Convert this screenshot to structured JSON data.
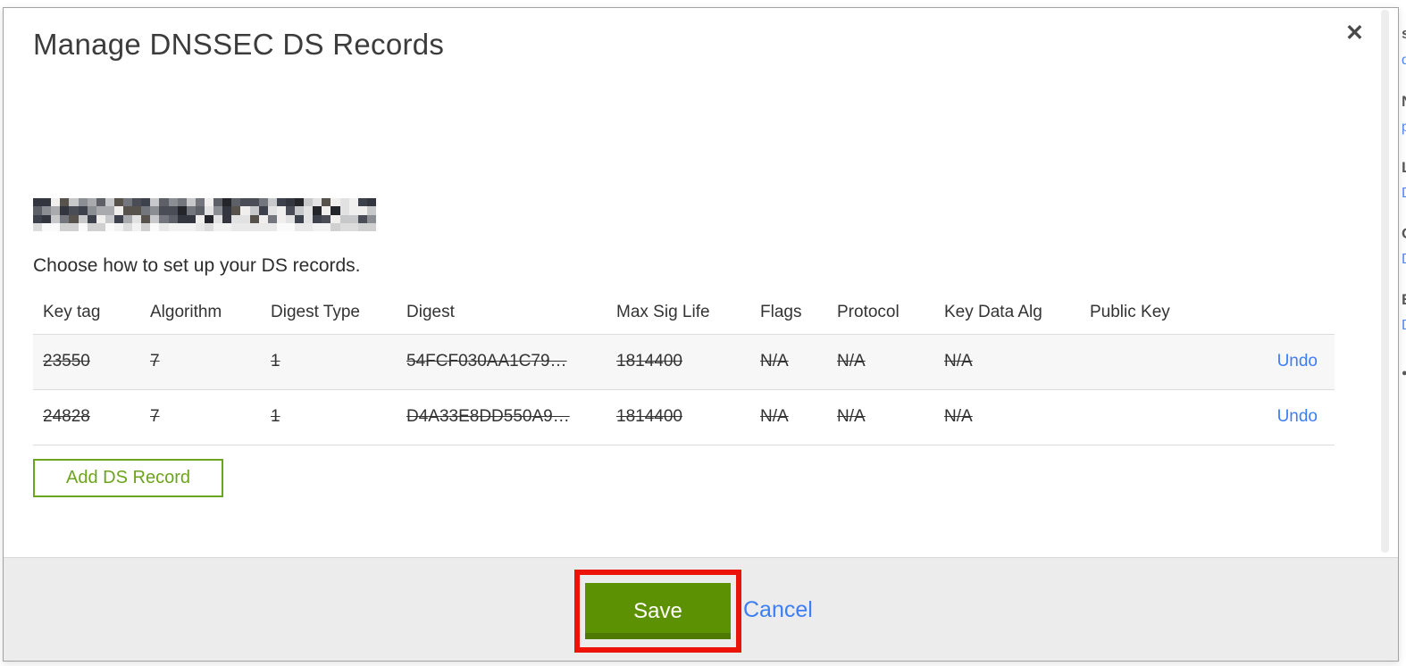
{
  "modal": {
    "title": "Manage DNSSEC DS Records",
    "close_glyph": "✕",
    "domain": {
      "redacted": true
    },
    "subtitle": "Choose how to set up your DS records.",
    "table": {
      "columns": [
        "Key tag",
        "Algorithm",
        "Digest Type",
        "Digest",
        "Max Sig Life",
        "Flags",
        "Protocol",
        "Key Data Alg",
        "Public Key"
      ],
      "rows": [
        {
          "key_tag": "23550",
          "algorithm": "7",
          "digest_type": "1",
          "digest": "54FCF030AA1C79…",
          "max_sig_life": "1814400",
          "flags": "N/A",
          "protocol": "N/A",
          "key_data_alg": "N/A",
          "public_key": "",
          "action": "Undo",
          "deleted": true
        },
        {
          "key_tag": "24828",
          "algorithm": "7",
          "digest_type": "1",
          "digest": "D4A33E8DD550A9…",
          "max_sig_life": "1814400",
          "flags": "N/A",
          "protocol": "N/A",
          "key_data_alg": "N/A",
          "public_key": "",
          "action": "Undo",
          "deleted": true
        }
      ]
    },
    "add_button_label": "Add DS Record",
    "footer": {
      "save_label": "Save",
      "cancel_label": "Cancel"
    }
  },
  "annotation": {
    "shape": "rectangle",
    "color": "#ec1309",
    "target": "save-button"
  },
  "background_sliver": {
    "description": "partially visible text fragments of page behind modal",
    "fragments": [
      "s",
      "d",
      "N",
      "p",
      "L",
      "D",
      "O",
      "D",
      "E",
      "D",
      "●"
    ]
  },
  "colors": {
    "accent_green": "#5d9104",
    "outline_green": "#6da41e",
    "link_blue": "#3d7ef5",
    "annotation_red": "#ec1309",
    "footer_gray": "#ececec",
    "row_stripe": "#f7f7f7"
  }
}
